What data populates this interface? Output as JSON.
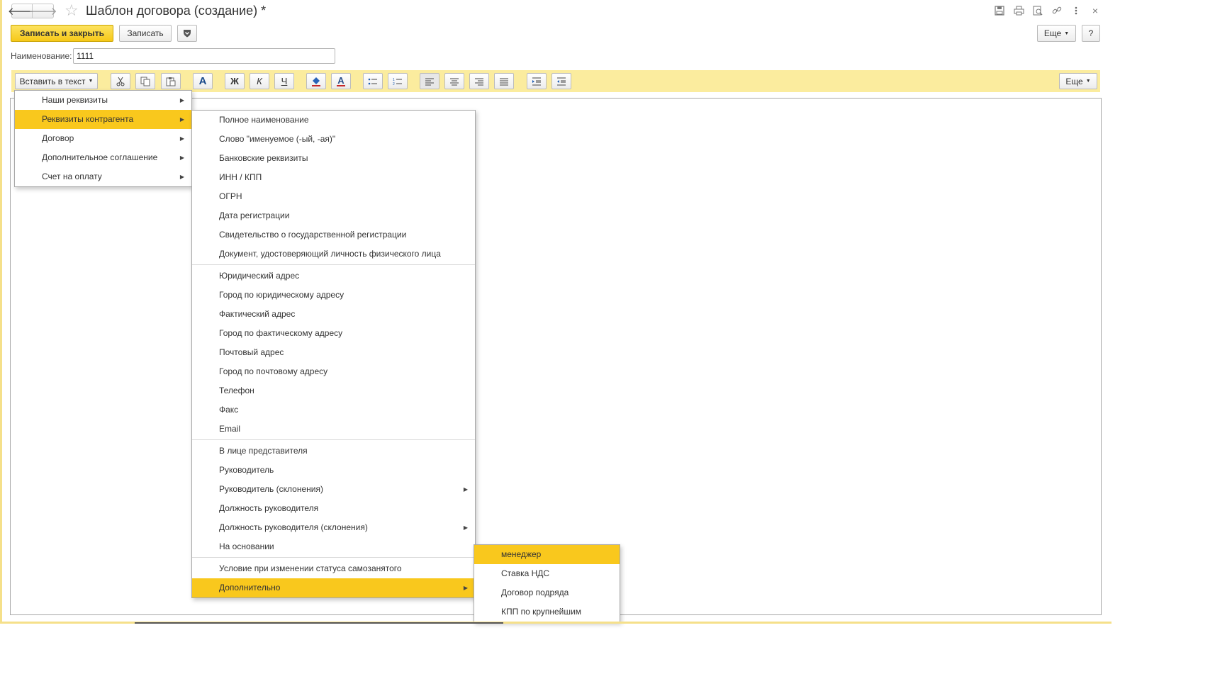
{
  "window": {
    "title": "Шаблон договора (создание) *",
    "icons": [
      "save-icon",
      "print-icon",
      "preview-icon",
      "link-icon",
      "kebab-icon",
      "close-icon"
    ]
  },
  "commands": {
    "save_close": "Записать и закрыть",
    "save": "Записать",
    "more": "Еще",
    "help": "?"
  },
  "form": {
    "name_label": "Наименование:",
    "name_value": "1111"
  },
  "toolbar": {
    "insert_label": "Вставить в текст",
    "more": "Еще",
    "font_glyph": "A",
    "bold_glyph": "Ж",
    "italic_glyph": "К",
    "underline_glyph": "Ч",
    "color_glyph": "A"
  },
  "menu_level1": [
    {
      "label": "Наши реквизиты",
      "submenu": true
    },
    {
      "label": "Реквизиты контрагента",
      "submenu": true,
      "active": true
    },
    {
      "label": "Договор",
      "submenu": true
    },
    {
      "label": "Дополнительное соглашение",
      "submenu": true
    },
    {
      "label": "Счет на оплату",
      "submenu": true
    }
  ],
  "menu_level2": [
    {
      "label": "Полное наименование"
    },
    {
      "label": "Слово \"именуемое (-ый, -ая)\""
    },
    {
      "label": "Банковские реквизиты"
    },
    {
      "label": "ИНН / КПП"
    },
    {
      "label": "ОГРН"
    },
    {
      "label": "Дата регистрации"
    },
    {
      "label": "Свидетельство о государственной регистрации"
    },
    {
      "label": "Документ, удостоверяющий личность физического лица"
    },
    {
      "label": "Юридический адрес",
      "sep_before": true
    },
    {
      "label": "Город по юридическому адресу"
    },
    {
      "label": "Фактический адрес"
    },
    {
      "label": "Город по фактическому адресу"
    },
    {
      "label": "Почтовый адрес"
    },
    {
      "label": "Город по почтовому адресу"
    },
    {
      "label": "Телефон"
    },
    {
      "label": "Факс"
    },
    {
      "label": "Email"
    },
    {
      "label": "В лице представителя",
      "sep_before": true
    },
    {
      "label": "Руководитель"
    },
    {
      "label": "Руководитель (склонения)",
      "submenu": true
    },
    {
      "label": "Должность руководителя"
    },
    {
      "label": "Должность руководителя (склонения)",
      "submenu": true
    },
    {
      "label": "На основании"
    },
    {
      "label": "Условие при изменении статуса самозанятого",
      "sep_before": true
    },
    {
      "label": "Дополнительно",
      "submenu": true,
      "active": true
    }
  ],
  "menu_level3": [
    {
      "label": "менеджер",
      "active": true
    },
    {
      "label": "Ставка НДС"
    },
    {
      "label": "Договор подряда"
    },
    {
      "label": "КПП по крупнейшим"
    }
  ]
}
